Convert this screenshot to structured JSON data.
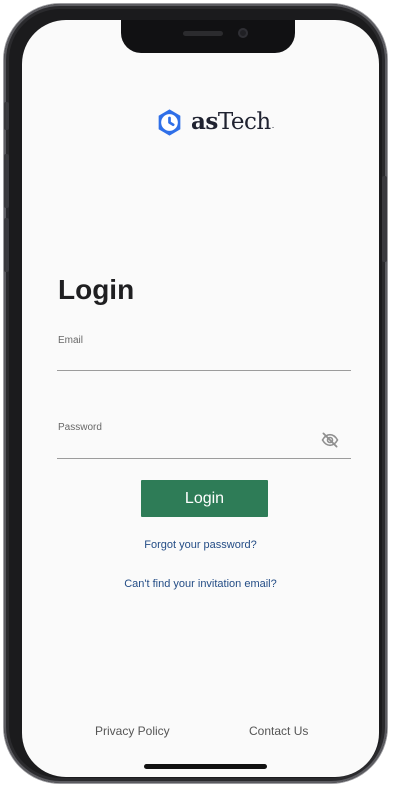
{
  "brand": {
    "name_bold": "as",
    "name_regular": "Tech",
    "name_suffix": ".",
    "accent_color": "#2f6fe8"
  },
  "login": {
    "title": "Login",
    "email_label": "Email",
    "email_value": "",
    "password_label": "Password",
    "password_value": "",
    "password_visibility_icon": "eye-off-icon",
    "submit_label": "Login",
    "forgot_password_label": "Forgot your password?",
    "invitation_email_label": "Can't find your invitation email?",
    "button_color": "#2e7c57",
    "link_color": "#244d86"
  },
  "footer": {
    "privacy_policy_label": "Privacy Policy",
    "contact_us_label": "Contact Us"
  }
}
